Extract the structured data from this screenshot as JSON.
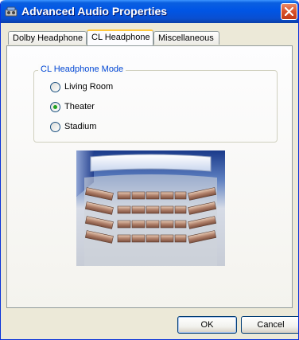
{
  "window": {
    "title": "Advanced Audio Properties",
    "accent": "#0055e5",
    "close_color": "#d9512a"
  },
  "tabs": [
    {
      "label": "Dolby Headphone",
      "active": false
    },
    {
      "label": "CL Headphone",
      "active": true
    },
    {
      "label": "Miscellaneous",
      "active": false
    }
  ],
  "mode_group": {
    "label": "CL Headphone Mode",
    "label_color": "#0046d5",
    "options": [
      {
        "label": "Living Room",
        "selected": false
      },
      {
        "label": "Theater",
        "selected": true
      },
      {
        "label": "Stadium",
        "selected": false
      }
    ]
  },
  "preview": {
    "icon": "theater-seating-illustration"
  },
  "buttons": {
    "ok": "OK",
    "cancel": "Cancel"
  }
}
